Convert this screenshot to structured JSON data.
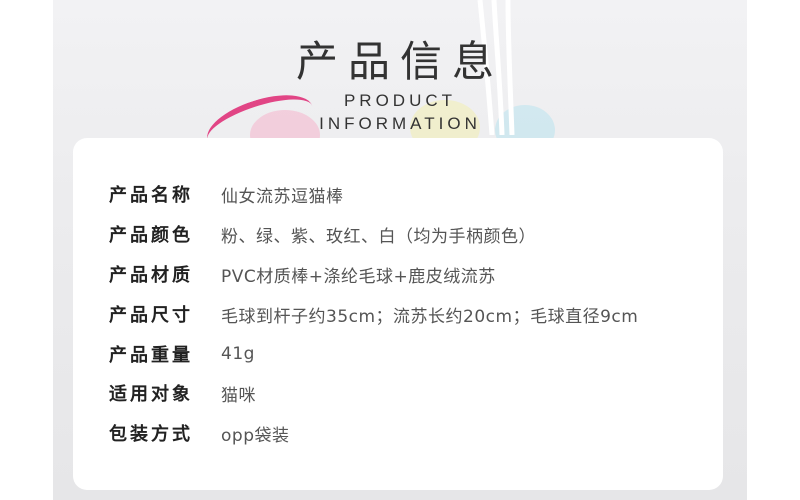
{
  "header": {
    "title_cn": "产品信息",
    "title_en_line1": "PRODUCT",
    "title_en_line2": "INFORMATION"
  },
  "info": [
    {
      "label": "产品名称",
      "value": "仙女流苏逗猫棒"
    },
    {
      "label": "产品颜色",
      "value": "粉、绿、紫、玫红、白（均为手柄颜色）"
    },
    {
      "label": "产品材质",
      "value": "PVC材质棒+涤纶毛球+鹿皮绒流苏"
    },
    {
      "label": "产品尺寸",
      "value": "毛球到杆子约35cm；流苏长约20cm；毛球直径9cm"
    },
    {
      "label": "产品重量",
      "value": "41g"
    },
    {
      "label": "适用对象",
      "value": "猫咪"
    },
    {
      "label": "包装方式",
      "value": "opp袋装"
    }
  ]
}
